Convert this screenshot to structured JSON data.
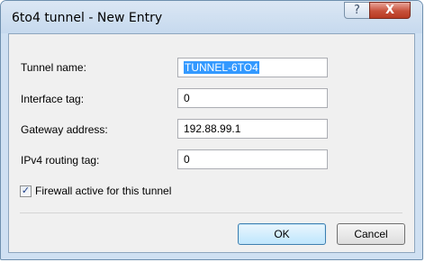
{
  "window": {
    "title": "6to4 tunnel - New Entry",
    "help_glyph": "?",
    "close_glyph": "X"
  },
  "form": {
    "tunnel_name": {
      "label": "Tunnel name:",
      "value": "TUNNEL-6TO4"
    },
    "interface_tag": {
      "label": "Interface tag:",
      "value": "0"
    },
    "gateway_address": {
      "label": "Gateway address:",
      "value": "192.88.99.1"
    },
    "ipv4_routing_tag": {
      "label": "IPv4 routing tag:",
      "value": "0"
    },
    "firewall": {
      "label": "Firewall active for this tunnel",
      "checked": true,
      "check_glyph": "✓"
    }
  },
  "buttons": {
    "ok_label": "OK",
    "cancel_label": "Cancel"
  },
  "colors": {
    "selection": "#3399ff",
    "close_button": "#c7503a",
    "titlebar": "#cfe0f2"
  },
  "icons": [
    "help-icon",
    "close-icon",
    "checkmark-icon"
  ]
}
